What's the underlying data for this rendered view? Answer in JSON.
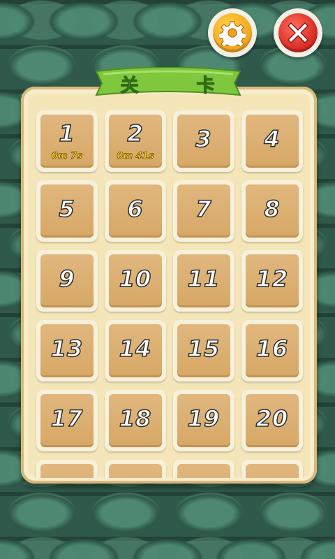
{
  "header": {
    "title": "关 卡"
  },
  "toolbar": {
    "settings_icon": "gear-icon",
    "close_icon": "close-icon",
    "settings_color": "#f2a21b",
    "close_color": "#d4261e"
  },
  "levels": [
    {
      "number": "1",
      "time": "0m 7s"
    },
    {
      "number": "2",
      "time": "0m 41s"
    },
    {
      "number": "3",
      "time": ""
    },
    {
      "number": "4",
      "time": ""
    },
    {
      "number": "5",
      "time": ""
    },
    {
      "number": "6",
      "time": ""
    },
    {
      "number": "7",
      "time": ""
    },
    {
      "number": "8",
      "time": ""
    },
    {
      "number": "9",
      "time": ""
    },
    {
      "number": "10",
      "time": ""
    },
    {
      "number": "11",
      "time": ""
    },
    {
      "number": "12",
      "time": ""
    },
    {
      "number": "13",
      "time": ""
    },
    {
      "number": "14",
      "time": ""
    },
    {
      "number": "15",
      "time": ""
    },
    {
      "number": "16",
      "time": ""
    },
    {
      "number": "17",
      "time": ""
    },
    {
      "number": "18",
      "time": ""
    },
    {
      "number": "19",
      "time": ""
    },
    {
      "number": "20",
      "time": ""
    },
    {
      "number": "",
      "time": ""
    },
    {
      "number": "",
      "time": ""
    },
    {
      "number": "",
      "time": ""
    },
    {
      "number": "",
      "time": ""
    }
  ]
}
